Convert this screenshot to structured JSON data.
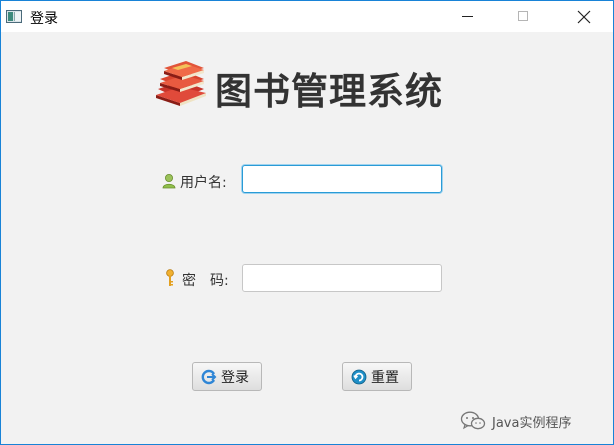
{
  "window": {
    "title": "登录",
    "controls": {
      "minimize": "minimize",
      "maximize": "maximize",
      "close": "close"
    }
  },
  "header": {
    "title": "图书管理系统",
    "icon": "books-icon"
  },
  "form": {
    "username": {
      "label": "用户名:",
      "value": "",
      "icon": "user-icon"
    },
    "password": {
      "label_first": "密",
      "label_second": "码:",
      "value": "",
      "icon": "key-icon"
    }
  },
  "buttons": {
    "login": {
      "label": "登录",
      "icon": "login-arrow-icon"
    },
    "reset": {
      "label": "重置",
      "icon": "reset-icon"
    }
  },
  "watermark": {
    "text": "Java实例程序",
    "icon": "wechat-icon"
  },
  "colors": {
    "window_border": "#1883d7",
    "focus_border": "#2a9bd6",
    "body_bg": "#f2f2f2"
  }
}
